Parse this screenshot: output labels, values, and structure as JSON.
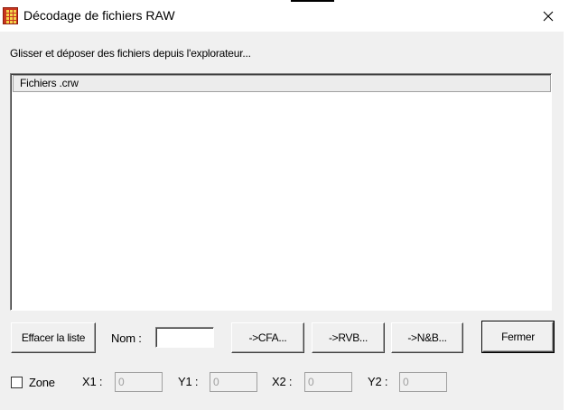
{
  "window": {
    "title": "Décodage de fichiers RAW",
    "app_icon": "raw-decoder-app-icon",
    "close_icon": "close-x-icon"
  },
  "hint": "Glisser et déposer des fichiers depuis l'explorateur...",
  "list": {
    "header": "Fichiers .crw",
    "items": []
  },
  "buttons": {
    "clear": "Effacer la liste",
    "cfa": "->CFA...",
    "rvb": "->RVB...",
    "nb": "->N&B...",
    "close": "Fermer"
  },
  "name_field": {
    "label": "Nom :",
    "value": ""
  },
  "zone": {
    "label": "Zone",
    "checked": false,
    "x1_label": "X1 :",
    "x1_value": "0",
    "y1_label": "Y1 :",
    "y1_value": "0",
    "x2_label": "X2 :",
    "x2_value": "0",
    "y2_label": "Y2 :",
    "y2_value": "0"
  }
}
